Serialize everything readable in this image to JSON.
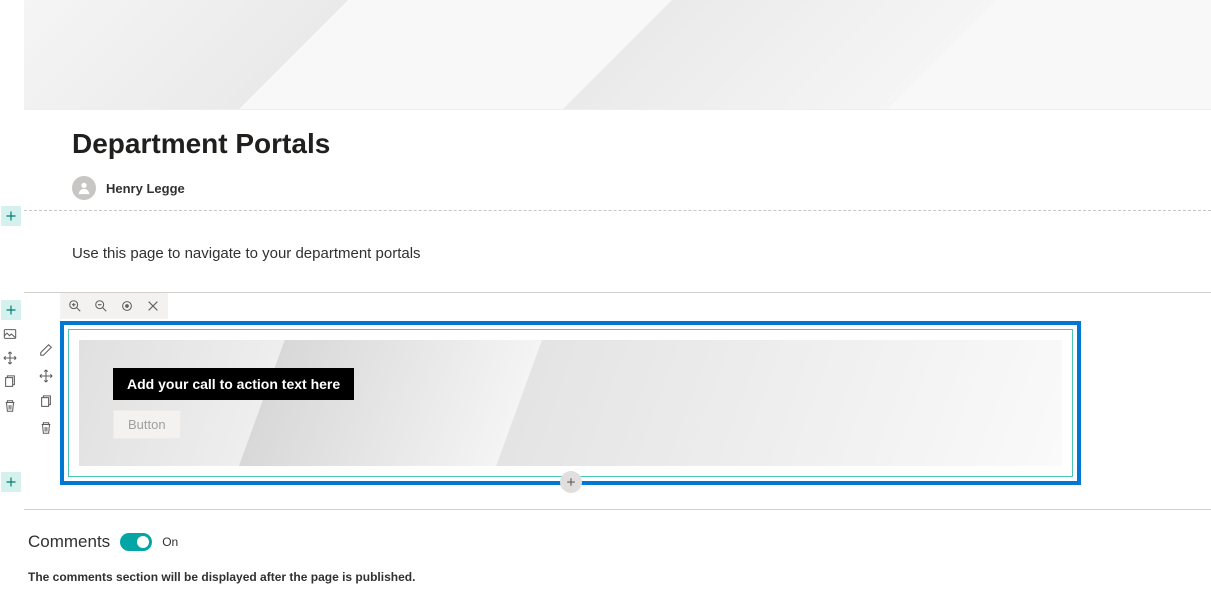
{
  "header": {
    "title": "Department Portals",
    "author": "Henry Legge"
  },
  "intro": {
    "text": "Use this page to navigate to your department portals"
  },
  "cta": {
    "headline": "Add your call to action text here",
    "button_label": "Button"
  },
  "comments": {
    "title": "Comments",
    "toggle_state": "On",
    "note": "The comments section will be displayed after the page is published."
  }
}
